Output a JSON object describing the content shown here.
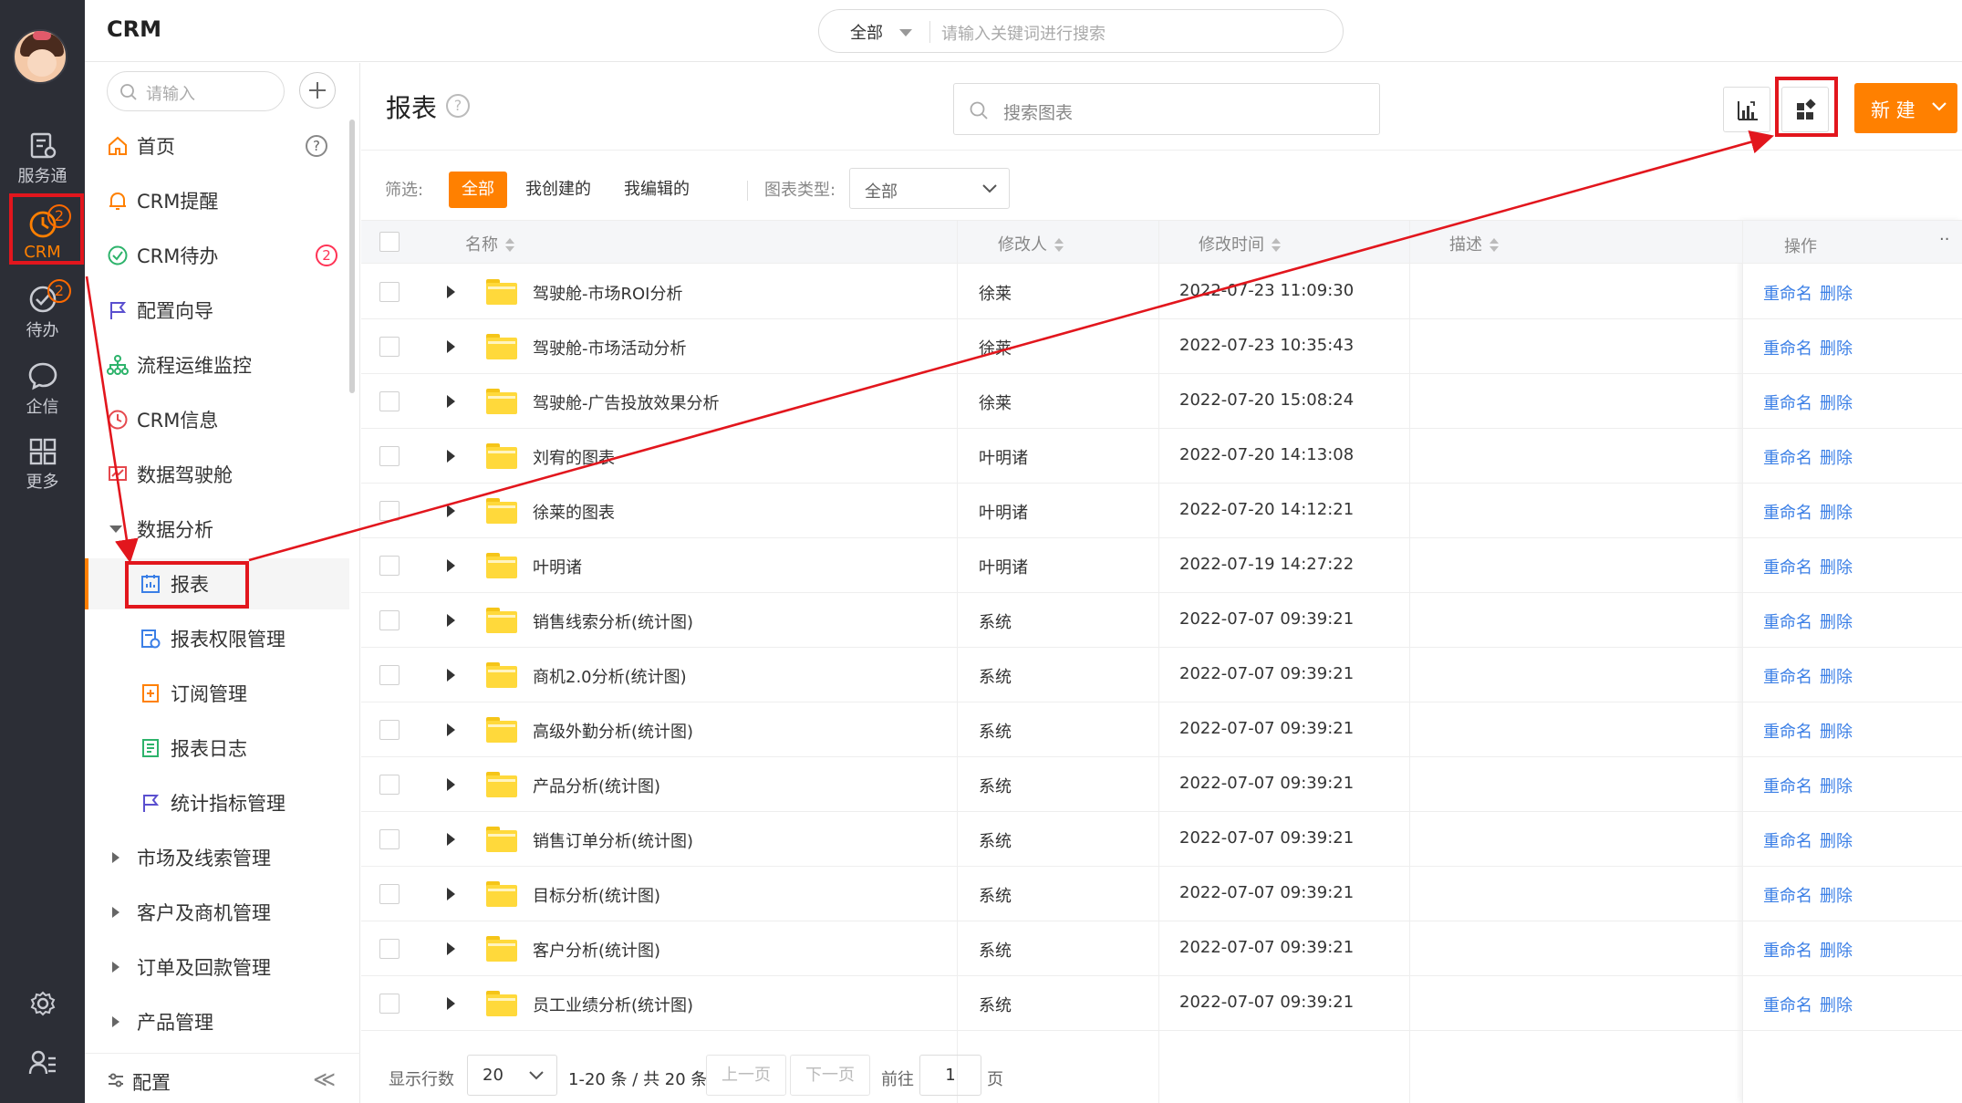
{
  "app": {
    "title": "CRM"
  },
  "global_search": {
    "scope": "全部",
    "placeholder": "请输入关键词进行搜索"
  },
  "rail": {
    "items": [
      {
        "label": "服务通",
        "icon": "service-icon"
      },
      {
        "label": "CRM",
        "icon": "crm-clock-icon",
        "badge": "2"
      },
      {
        "label": "待办",
        "icon": "todo-check-icon",
        "badge": "2"
      },
      {
        "label": "企信",
        "icon": "chat-bubble-icon"
      },
      {
        "label": "更多",
        "icon": "grid-icon"
      }
    ],
    "bottom": [
      "settings-gear-icon",
      "user-list-icon"
    ]
  },
  "nav": {
    "search_placeholder": "请输入",
    "items": [
      {
        "label": "首页",
        "icon": "home-icon"
      },
      {
        "label": "CRM提醒",
        "icon": "bell-icon"
      },
      {
        "label": "CRM待办",
        "icon": "check-circle-icon",
        "badge": "2"
      },
      {
        "label": "配置向导",
        "icon": "flag-icon"
      },
      {
        "label": "流程运维监控",
        "icon": "org-tree-icon"
      },
      {
        "label": "CRM信息",
        "icon": "clock-icon"
      },
      {
        "label": "数据驾驶舱",
        "icon": "dashboard-icon"
      },
      {
        "label": "数据分析",
        "icon": "caret-down-icon"
      },
      {
        "label": "报表",
        "icon": "report-icon"
      },
      {
        "label": "报表权限管理",
        "icon": "report-permission-icon"
      },
      {
        "label": "订阅管理",
        "icon": "subscribe-icon"
      },
      {
        "label": "报表日志",
        "icon": "log-icon"
      },
      {
        "label": "统计指标管理",
        "icon": "flag-icon"
      },
      {
        "label": "市场及线索管理",
        "icon": "caret-right-icon"
      },
      {
        "label": "客户及商机管理",
        "icon": "caret-right-icon"
      },
      {
        "label": "订单及回款管理",
        "icon": "caret-right-icon"
      },
      {
        "label": "产品管理",
        "icon": "caret-right-icon"
      }
    ],
    "footer_label": "配置",
    "collapse_label": "≪"
  },
  "main": {
    "title": "报表",
    "chart_search_placeholder": "搜索图表",
    "new_button": "新 建",
    "filter": {
      "label": "筛选:",
      "chips": [
        "全部",
        "我创建的",
        "我编辑的"
      ],
      "type_label": "图表类型:",
      "type_value": "全部"
    },
    "columns": {
      "name": "名称",
      "modifier": "修改人",
      "time": "修改时间",
      "desc": "描述",
      "op": "操作",
      "more": "··"
    },
    "rows": [
      {
        "name": "驾驶舱-市场ROI分析",
        "modifier": "徐莱",
        "time": "2022-07-23 11:09:30"
      },
      {
        "name": "驾驶舱-市场活动分析",
        "modifier": "徐莱",
        "time": "2022-07-23 10:35:43"
      },
      {
        "name": "驾驶舱-广告投放效果分析",
        "modifier": "徐莱",
        "time": "2022-07-20 15:08:24"
      },
      {
        "name": "刘宥的图表",
        "modifier": "叶明诸",
        "time": "2022-07-20 14:13:08"
      },
      {
        "name": "徐莱的图表",
        "modifier": "叶明诸",
        "time": "2022-07-20 14:12:21"
      },
      {
        "name": "叶明诸",
        "modifier": "叶明诸",
        "time": "2022-07-19 14:27:22"
      },
      {
        "name": "销售线索分析(统计图)",
        "modifier": "系统",
        "time": "2022-07-07 09:39:21"
      },
      {
        "name": "商机2.0分析(统计图)",
        "modifier": "系统",
        "time": "2022-07-07 09:39:21"
      },
      {
        "name": "高级外勤分析(统计图)",
        "modifier": "系统",
        "time": "2022-07-07 09:39:21"
      },
      {
        "name": "产品分析(统计图)",
        "modifier": "系统",
        "time": "2022-07-07 09:39:21"
      },
      {
        "name": "销售订单分析(统计图)",
        "modifier": "系统",
        "time": "2022-07-07 09:39:21"
      },
      {
        "name": "目标分析(统计图)",
        "modifier": "系统",
        "time": "2022-07-07 09:39:21"
      },
      {
        "name": "客户分析(统计图)",
        "modifier": "系统",
        "time": "2022-07-07 09:39:21"
      },
      {
        "name": "员工业绩分析(统计图)",
        "modifier": "系统",
        "time": "2022-07-07 09:39:21"
      }
    ],
    "row_actions": {
      "rename": "重命名",
      "delete": "删除"
    },
    "pager": {
      "rows_label": "显示行数",
      "page_size": "20",
      "range": "1-20 条 / 共 20 条",
      "prev": "上一页",
      "next": "下一页",
      "goto_label": "前往",
      "page": "1",
      "page_suffix": "页"
    }
  },
  "colors": {
    "accent": "#ff8000",
    "rail": "#2c2e36",
    "link": "#3b7fe6",
    "annotation": "#e2161d"
  }
}
